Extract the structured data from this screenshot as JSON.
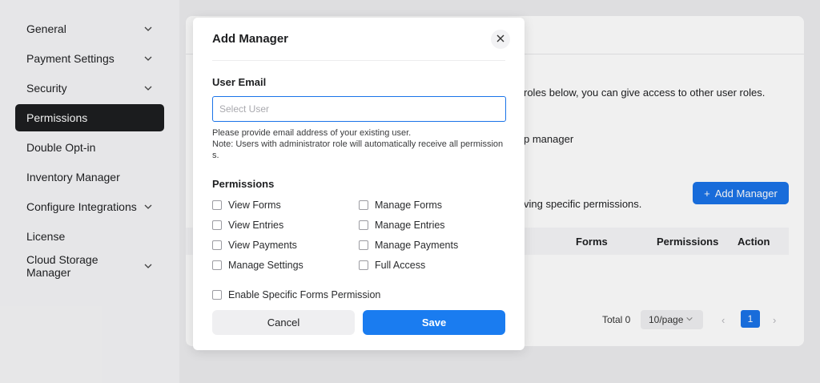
{
  "sidebar": {
    "items": [
      {
        "label": "General",
        "has_chevron": true
      },
      {
        "label": "Payment Settings",
        "has_chevron": true
      },
      {
        "label": "Security",
        "has_chevron": true
      },
      {
        "label": "Permissions",
        "has_chevron": false,
        "active": true
      },
      {
        "label": "Double Opt-in",
        "has_chevron": false
      },
      {
        "label": "Inventory Manager",
        "has_chevron": false
      },
      {
        "label": "Configure Integrations",
        "has_chevron": true
      },
      {
        "label": "License",
        "has_chevron": false
      },
      {
        "label": "Cloud Storage Manager",
        "has_chevron": true
      }
    ]
  },
  "background": {
    "roles_text": "roles below, you can give access to other user roles.",
    "manager_text": "p manager",
    "specific_text": "ving specific permissions.",
    "add_manager_label": "Add Manager",
    "table_headers": {
      "forms": "Forms",
      "permissions": "Permissions",
      "action": "Action"
    },
    "pager": {
      "total": "Total 0",
      "page_size": "10/page",
      "current_page": "1"
    }
  },
  "modal": {
    "title": "Add Manager",
    "user_email_label": "User Email",
    "email_placeholder": "Select User",
    "help_line1": "Please provide email address of your existing user.",
    "help_line2": "Note: Users with administrator role will automatically receive all permission",
    "help_line3": "s.",
    "permissions_label": "Permissions",
    "permissions": [
      {
        "label": "View Forms",
        "checked": false
      },
      {
        "label": "Manage Forms",
        "checked": false
      },
      {
        "label": "View Entries",
        "checked": false
      },
      {
        "label": "Manage Entries",
        "checked": false
      },
      {
        "label": "View Payments",
        "checked": false
      },
      {
        "label": "Manage Payments",
        "checked": false
      },
      {
        "label": "Manage Settings",
        "checked": false
      },
      {
        "label": "Full Access",
        "checked": false
      }
    ],
    "specific_forms_label": "Enable Specific Forms Permission",
    "cancel_label": "Cancel",
    "save_label": "Save"
  },
  "colors": {
    "accent": "#1a73e8",
    "active_nav": "#1d1e20"
  }
}
